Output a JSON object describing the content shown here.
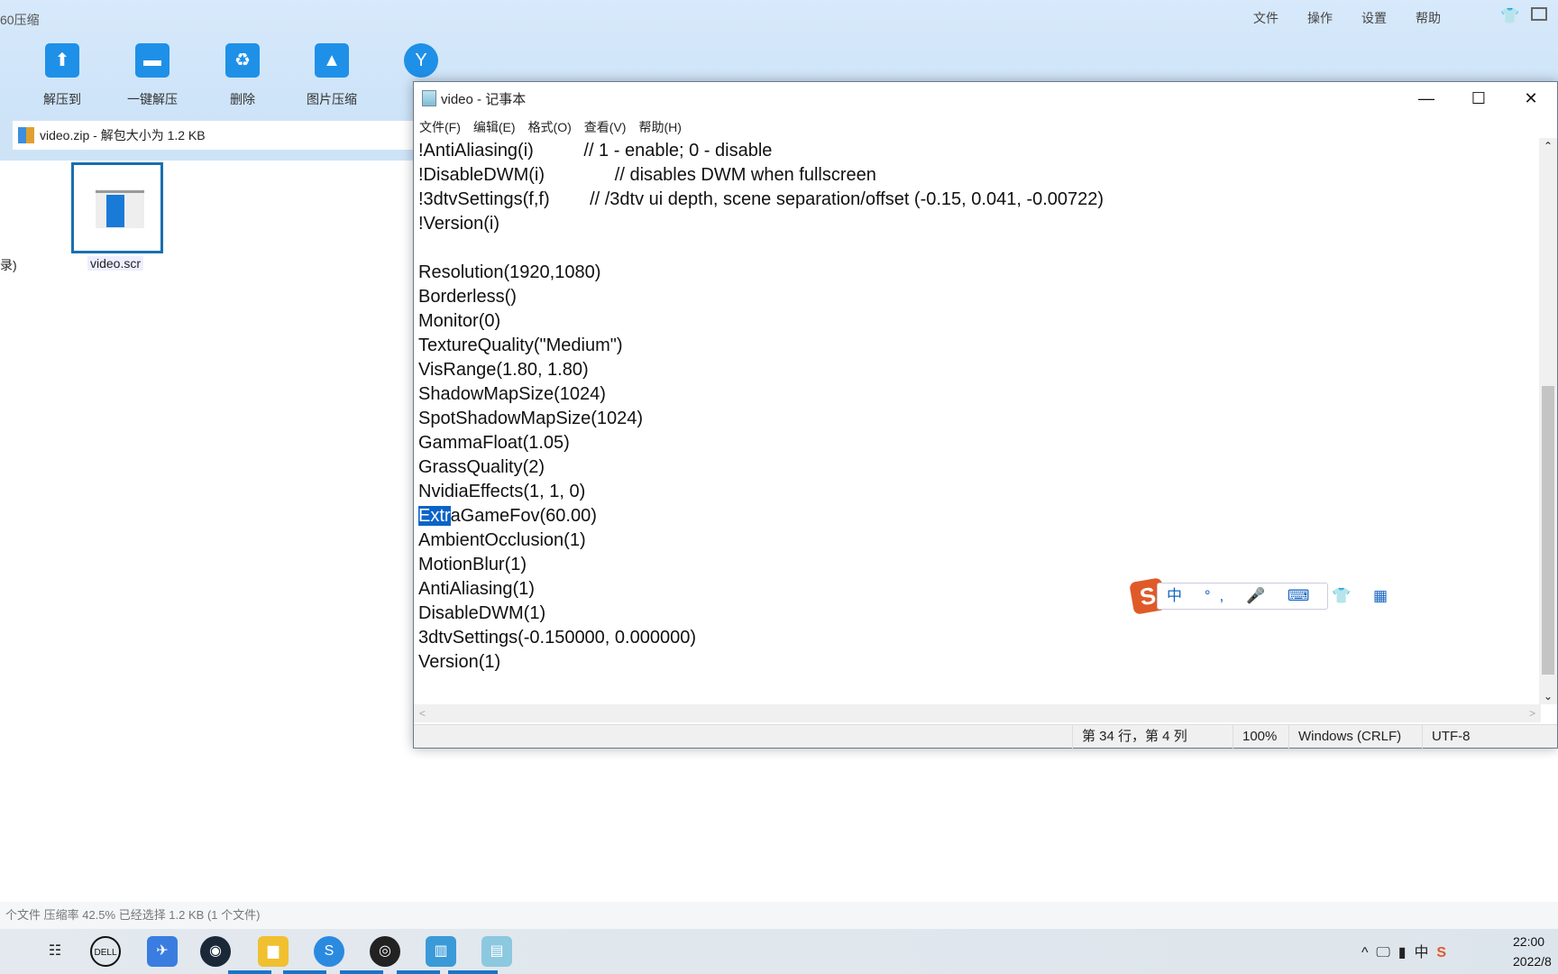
{
  "zip": {
    "title": "60压缩",
    "menu": [
      "文件",
      "操作",
      "设置",
      "帮助"
    ],
    "tools": [
      "解压到",
      "一键解压",
      "删除",
      "图片压缩"
    ],
    "address": "video.zip - 解包大小为 1.2 KB",
    "file": "video.scr",
    "left_cut": "录)",
    "status": "个文件 压缩率 42.5% 已经选择 1.2 KB (1 个文件)"
  },
  "notepad": {
    "title": "video - 记事本",
    "menu": [
      "文件(F)",
      "编辑(E)",
      "格式(O)",
      "查看(V)",
      "帮助(H)"
    ],
    "lines": [
      "!AntiAliasing(i)          // 1 - enable; 0 - disable",
      "!DisableDWM(i)              // disables DWM when fullscreen",
      "!3dtvSettings(f,f)        // /3dtv ui depth, scene separation/offset (-0.15, 0.041, -0.00722)",
      "!Version(i)",
      "",
      "Resolution(1920,1080)",
      "Borderless()",
      "Monitor(0)",
      "TextureQuality(\"Medium\")",
      "VisRange(1.80, 1.80)",
      "ShadowMapSize(1024)",
      "SpotShadowMapSize(1024)",
      "GammaFloat(1.05)",
      "GrassQuality(2)",
      "NvidiaEffects(1, 1, 0)"
    ],
    "sel_line": {
      "selected": "Extr",
      "rest": "aGameFov(60.00)"
    },
    "lines2": [
      "AmbientOcclusion(1)",
      "MotionBlur(1)",
      "AntiAliasing(1)",
      "DisableDWM(1)",
      "3dtvSettings(-0.150000, 0.000000)",
      "Version(1)"
    ],
    "status": {
      "position": "第 34 行，第 4 列",
      "zoom": "100%",
      "eol": "Windows (CRLF)",
      "encoding": "UTF-8"
    }
  },
  "ime": {
    "logo": "S",
    "items": "中 °, 🎤 ⌨ 👕 ▦"
  },
  "clock": {
    "time": "22:00",
    "date": "2022/8"
  }
}
